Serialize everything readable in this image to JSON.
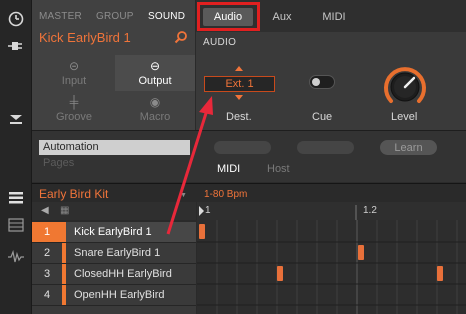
{
  "left_strip": {
    "icons": [
      "clock-icon",
      "plug-icon",
      "sidebar-toggle-icon"
    ],
    "bottom_icons": [
      "list-view-icon",
      "grid-view-icon",
      "waveform-icon"
    ]
  },
  "source_nav": {
    "items": [
      "MASTER",
      "GROUP",
      "SOUND"
    ],
    "active": "SOUND",
    "sound_name": "Kick EarlyBird 1"
  },
  "source_buttons": [
    {
      "label": "Input",
      "icon": "input-icon"
    },
    {
      "label": "Output",
      "icon": "output-icon"
    },
    {
      "label": "Groove",
      "icon": "groove-icon"
    },
    {
      "label": "Macro",
      "icon": "macro-icon"
    }
  ],
  "tabs": [
    "Audio",
    "Aux",
    "MIDI"
  ],
  "active_tab": "Audio",
  "audio": {
    "section_label": "AUDIO",
    "dest_value": "Ext. 1",
    "dest_label": "Dest.",
    "cue_label": "Cue",
    "level_label": "Level"
  },
  "automation": {
    "label": "Automation",
    "pages_label": "Pages",
    "learn_label": "Learn",
    "midi_tab": "MIDI",
    "host_tab": "Host"
  },
  "pattern": {
    "group_name": "Early Bird Kit",
    "bpm_text": "1-80 Bpm",
    "ticks": [
      "1",
      "1.2"
    ]
  },
  "pads": [
    {
      "num": "1",
      "name": "Kick EarlyBird 1"
    },
    {
      "num": "2",
      "name": "Snare EarlyBird 1"
    },
    {
      "num": "3",
      "name": "ClosedHH EarlyBird"
    },
    {
      "num": "4",
      "name": "OpenHH EarlyBird"
    }
  ],
  "colors": {
    "accent": "#f0743a",
    "highlight_box": "#e12020",
    "arrow": "#e8283a"
  }
}
